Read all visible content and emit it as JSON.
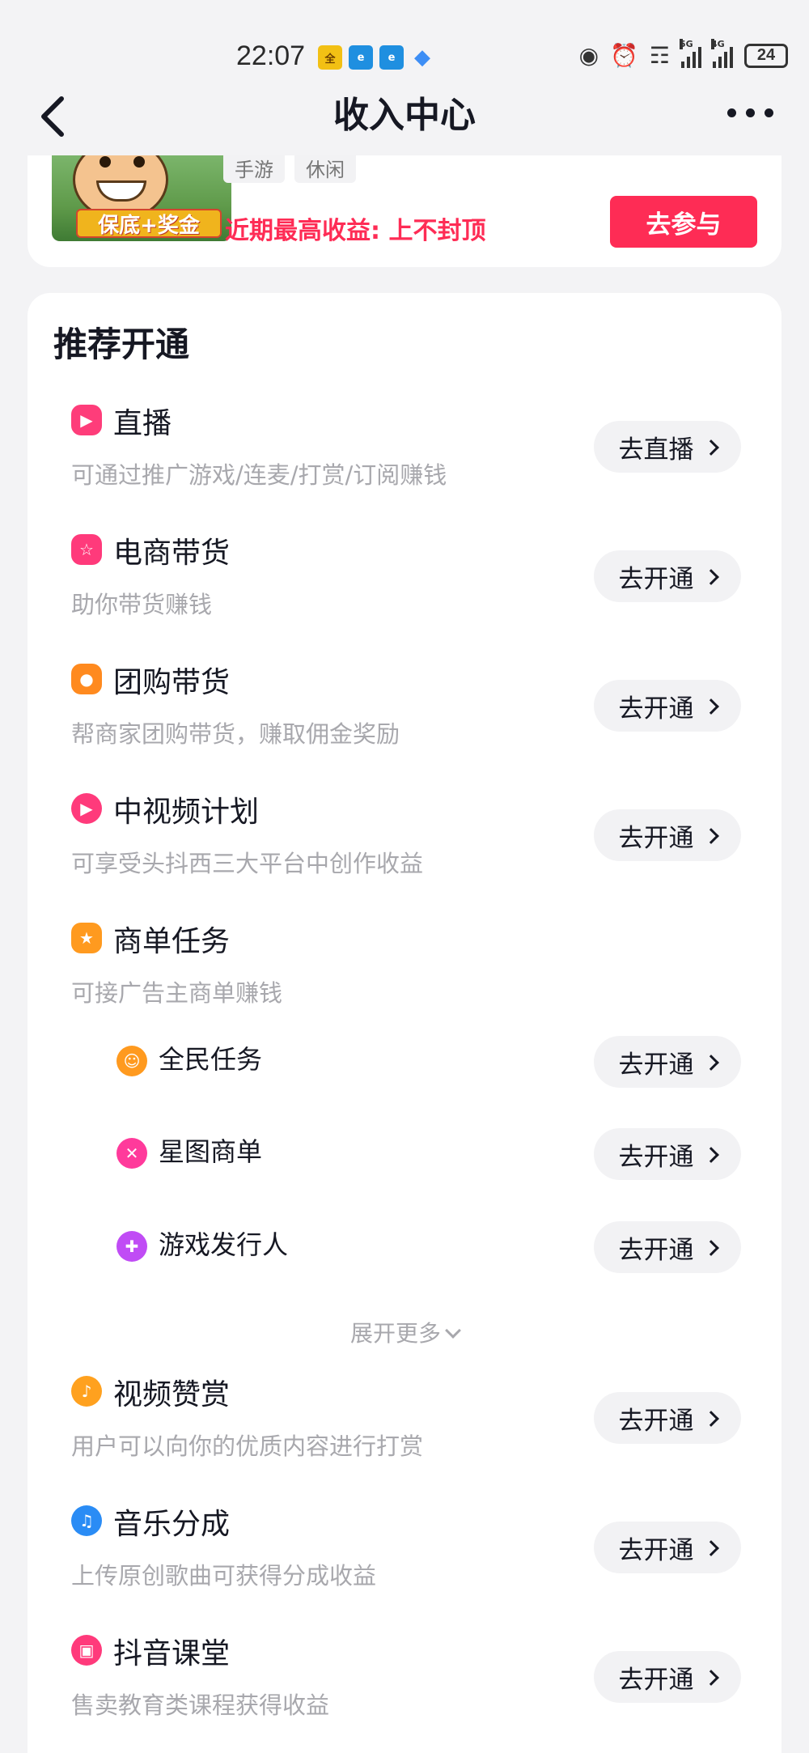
{
  "status_bar": {
    "time": "22:07",
    "battery": "24",
    "icons": [
      "news-app-icon",
      "browser-icon",
      "browser-icon",
      "shield-icon",
      "eye-icon",
      "alarm-icon",
      "wifi-icon",
      "signal-5g-icon",
      "signal-4g-icon",
      "battery-icon"
    ],
    "net1": "5G",
    "net2": "4G"
  },
  "header": {
    "title": "收入中心"
  },
  "promo": {
    "tags": [
      "手游",
      "休闲"
    ],
    "badge": "保底+奖金",
    "text": "近期最高收益: 上不封顶",
    "button": "去参与"
  },
  "section": {
    "title": "推荐开通"
  },
  "items": [
    {
      "title": "直播",
      "desc": "可通过推广游戏/连麦/打赏/订阅赚钱",
      "button": "去直播",
      "icon": "live-camera-icon",
      "color": "#fe3d7a"
    },
    {
      "title": "电商带货",
      "desc": "助你带货赚钱",
      "button": "去开通",
      "icon": "shopping-cart-icon",
      "color": "#ff3a7b"
    },
    {
      "title": "团购带货",
      "desc": "帮商家团购带货，赚取佣金奖励",
      "button": "去开通",
      "icon": "group-buy-icon",
      "color": "#ff8a1f"
    },
    {
      "title": "中视频计划",
      "desc": "可享受头抖西三大平台中创作收益",
      "button": "去开通",
      "icon": "video-plan-icon",
      "color": "#ff3a7b"
    },
    {
      "title": "商单任务",
      "desc": "可接广告主商单赚钱",
      "icon": "trophy-icon",
      "color": "#ff9a1f"
    }
  ],
  "sub_items": [
    {
      "title": "全民任务",
      "button": "去开通",
      "icon": "people-task-icon",
      "color": "#ff9a1f"
    },
    {
      "title": "星图商单",
      "button": "去开通",
      "icon": "star-map-icon",
      "color": "#ff3a9b"
    },
    {
      "title": "游戏发行人",
      "button": "去开通",
      "icon": "game-publisher-icon",
      "color": "#c04cf5"
    }
  ],
  "expand_more": "展开更多",
  "more_items": [
    {
      "title": "视频赞赏",
      "desc": "用户可以向你的优质内容进行打赏",
      "button": "去开通",
      "icon": "video-reward-icon",
      "color": "#ffa11f"
    },
    {
      "title": "音乐分成",
      "desc": "上传原创歌曲可获得分成收益",
      "button": "去开通",
      "icon": "music-share-icon",
      "color": "#2a8cf5"
    },
    {
      "title": "抖音课堂",
      "desc": "售卖教育类课程获得收益",
      "button": "去开通",
      "icon": "course-icon",
      "color": "#ff3a7b"
    }
  ]
}
